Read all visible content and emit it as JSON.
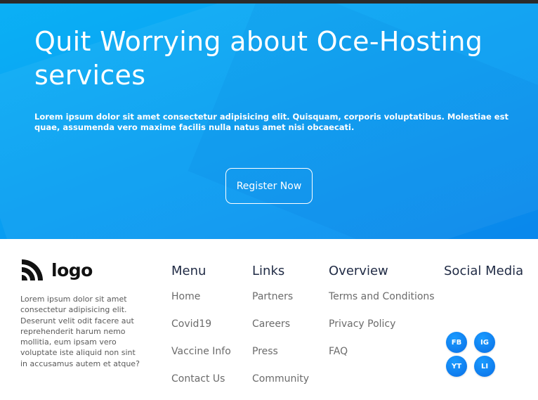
{
  "hero": {
    "title": "Quit Worrying about Oce-Hosting services",
    "text": "Lorem ipsum dolor sit amet consectetur adipisicing elit. Quisquam, corporis voluptatibus. Molestiae est quae, assumenda vero maxime facilis nulla natus amet nisi obcaecati.",
    "register_label": "Register Now"
  },
  "footer": {
    "logo_text": "logo",
    "about": "Lorem ipsum dolor sit amet consectetur adipisicing elit. Deserunt velit odit facere aut reprehenderit harum nemo mollitia, eum ipsam vero voluptate iste aliquid non sint in accusamus autem et atque?",
    "menu": {
      "title": "Menu",
      "items": [
        {
          "label": "Home"
        },
        {
          "label": "Covid19"
        },
        {
          "label": "Vaccine Info"
        },
        {
          "label": "Contact Us"
        }
      ]
    },
    "links": {
      "title": "Links",
      "items": [
        {
          "label": "Partners"
        },
        {
          "label": "Careers"
        },
        {
          "label": "Press"
        },
        {
          "label": "Community"
        }
      ]
    },
    "overview": {
      "title": "Overview",
      "items": [
        {
          "label": "Terms and Conditions"
        },
        {
          "label": "Privacy Policy"
        },
        {
          "label": "FAQ"
        }
      ]
    },
    "social": {
      "title": "Social Media",
      "buttons": [
        {
          "label": "FB",
          "icon": "facebook-icon"
        },
        {
          "label": "IG",
          "icon": "instagram-icon"
        },
        {
          "label": "YT",
          "icon": "youtube-icon"
        },
        {
          "label": "LI",
          "icon": "linkedin-icon"
        }
      ]
    }
  },
  "colors": {
    "hero_gradient_start": "#0bb0f5",
    "hero_gradient_end": "#0a8cf0",
    "social_button": "#0a6fe6",
    "heading": "#1f2a44",
    "link": "#6b6b6b"
  }
}
